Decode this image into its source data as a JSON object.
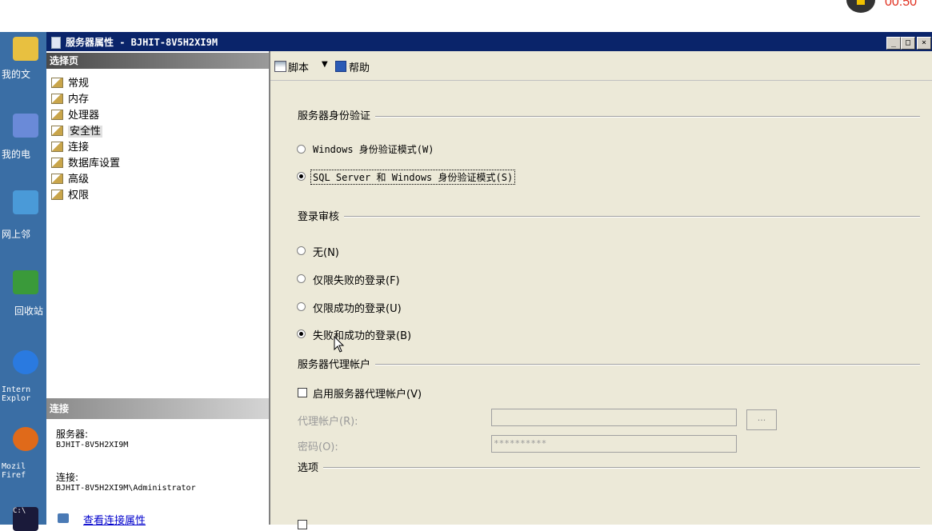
{
  "recorder": {
    "time": "00:50"
  },
  "desktop": {
    "icons": [
      {
        "label": "我的文",
        "color": "#e8c040"
      },
      {
        "label": "我的电",
        "color": "#6a8ad8"
      },
      {
        "label": "网上邻",
        "color": "#4a9ad8"
      },
      {
        "label": "回收站",
        "color": "#3a9a3a"
      },
      {
        "label": "Intern\nExplor",
        "color": "#2a7ae0"
      },
      {
        "label": "Mozil\nFiref",
        "color": "#e06a1a"
      },
      {
        "label": "C:\\",
        "color": "#1a1a3a"
      }
    ]
  },
  "window": {
    "title": "服务器属性 - BJHIT-8V5H2XI9M",
    "minimize": "_",
    "maximize": "□",
    "close": "×"
  },
  "left_pane": {
    "header": "选择页",
    "items": [
      {
        "label": "常规",
        "selected": false
      },
      {
        "label": "内存",
        "selected": false
      },
      {
        "label": "处理器",
        "selected": false
      },
      {
        "label": "安全性",
        "selected": true
      },
      {
        "label": "连接",
        "selected": false
      },
      {
        "label": "数据库设置",
        "selected": false
      },
      {
        "label": "高级",
        "selected": false
      },
      {
        "label": "权限",
        "selected": false
      }
    ],
    "connection": {
      "header": "连接",
      "server_label": "服务器:",
      "server_value": "BJHIT-8V5H2XI9M",
      "conn_label": "连接:",
      "conn_value": "BJHIT-8V5H2XI9M\\Administrator",
      "view_link": "查看连接属性"
    }
  },
  "toolbar": {
    "script_label": "脚本",
    "help_label": "帮助"
  },
  "security": {
    "auth_section": "服务器身份验证",
    "auth_options": [
      {
        "label": "Windows 身份验证模式(W)",
        "checked": false
      },
      {
        "label": "SQL Server 和 Windows 身份验证模式(S)",
        "checked": true
      }
    ],
    "audit_section": "登录审核",
    "audit_options": [
      {
        "label": "无(N)",
        "checked": false
      },
      {
        "label": "仅限失败的登录(F)",
        "checked": false
      },
      {
        "label": "仅限成功的登录(U)",
        "checked": false
      },
      {
        "label": "失败和成功的登录(B)",
        "checked": true
      }
    ],
    "proxy_section": "服务器代理帐户",
    "proxy_enable": "启用服务器代理帐户(V)",
    "proxy_account_label": "代理帐户(R):",
    "proxy_account_value": "",
    "password_label": "密码(O):",
    "password_value": "**********",
    "browse_label": "...",
    "options_section": "选项"
  }
}
